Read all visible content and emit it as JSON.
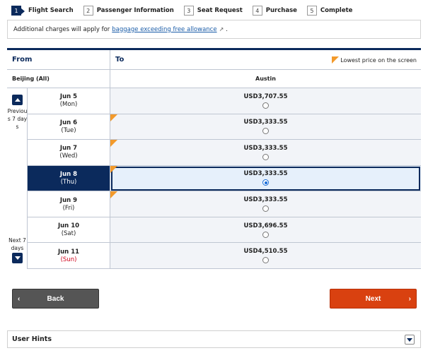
{
  "steps": [
    {
      "num": "1",
      "label": "Flight Search",
      "active": true
    },
    {
      "num": "2",
      "label": "Passenger Information",
      "active": false
    },
    {
      "num": "3",
      "label": "Seat Request",
      "active": false
    },
    {
      "num": "4",
      "label": "Purchase",
      "active": false
    },
    {
      "num": "5",
      "label": "Complete",
      "active": false
    }
  ],
  "notice": {
    "text_before": "Additional charges will apply for",
    "link_text": "baggage exceeding free allowance",
    "text_after": "."
  },
  "table": {
    "from_header": "From",
    "to_header": "To",
    "legend_label": "Lowest price on the screen",
    "legend_color": "#f39a2b",
    "origin": "Beijing (All)",
    "destination": "Austin",
    "prev_label": "Previous 7 days",
    "next_label": "Next 7 days",
    "rows": [
      {
        "date": "Jun 5",
        "weekday": "(Mon)",
        "price": "USD3,707.55",
        "lowest": false,
        "selected": false,
        "sunday": false
      },
      {
        "date": "Jun 6",
        "weekday": "(Tue)",
        "price": "USD3,333.55",
        "lowest": true,
        "selected": false,
        "sunday": false
      },
      {
        "date": "Jun 7",
        "weekday": "(Wed)",
        "price": "USD3,333.55",
        "lowest": true,
        "selected": false,
        "sunday": false
      },
      {
        "date": "Jun 8",
        "weekday": "(Thu)",
        "price": "USD3,333.55",
        "lowest": true,
        "selected": true,
        "sunday": false
      },
      {
        "date": "Jun 9",
        "weekday": "(Fri)",
        "price": "USD3,333.55",
        "lowest": true,
        "selected": false,
        "sunday": false
      },
      {
        "date": "Jun 10",
        "weekday": "(Sat)",
        "price": "USD3,696.55",
        "lowest": false,
        "selected": false,
        "sunday": false
      },
      {
        "date": "Jun 11",
        "weekday": "(Sun)",
        "price": "USD4,510.55",
        "lowest": false,
        "selected": false,
        "sunday": true
      }
    ]
  },
  "buttons": {
    "back_label": "Back",
    "next_label": "Next",
    "back_color": "#555555",
    "next_color": "#d94110"
  },
  "hints": {
    "title": "User Hints"
  },
  "colors": {
    "brand": "#0b2a5c"
  }
}
